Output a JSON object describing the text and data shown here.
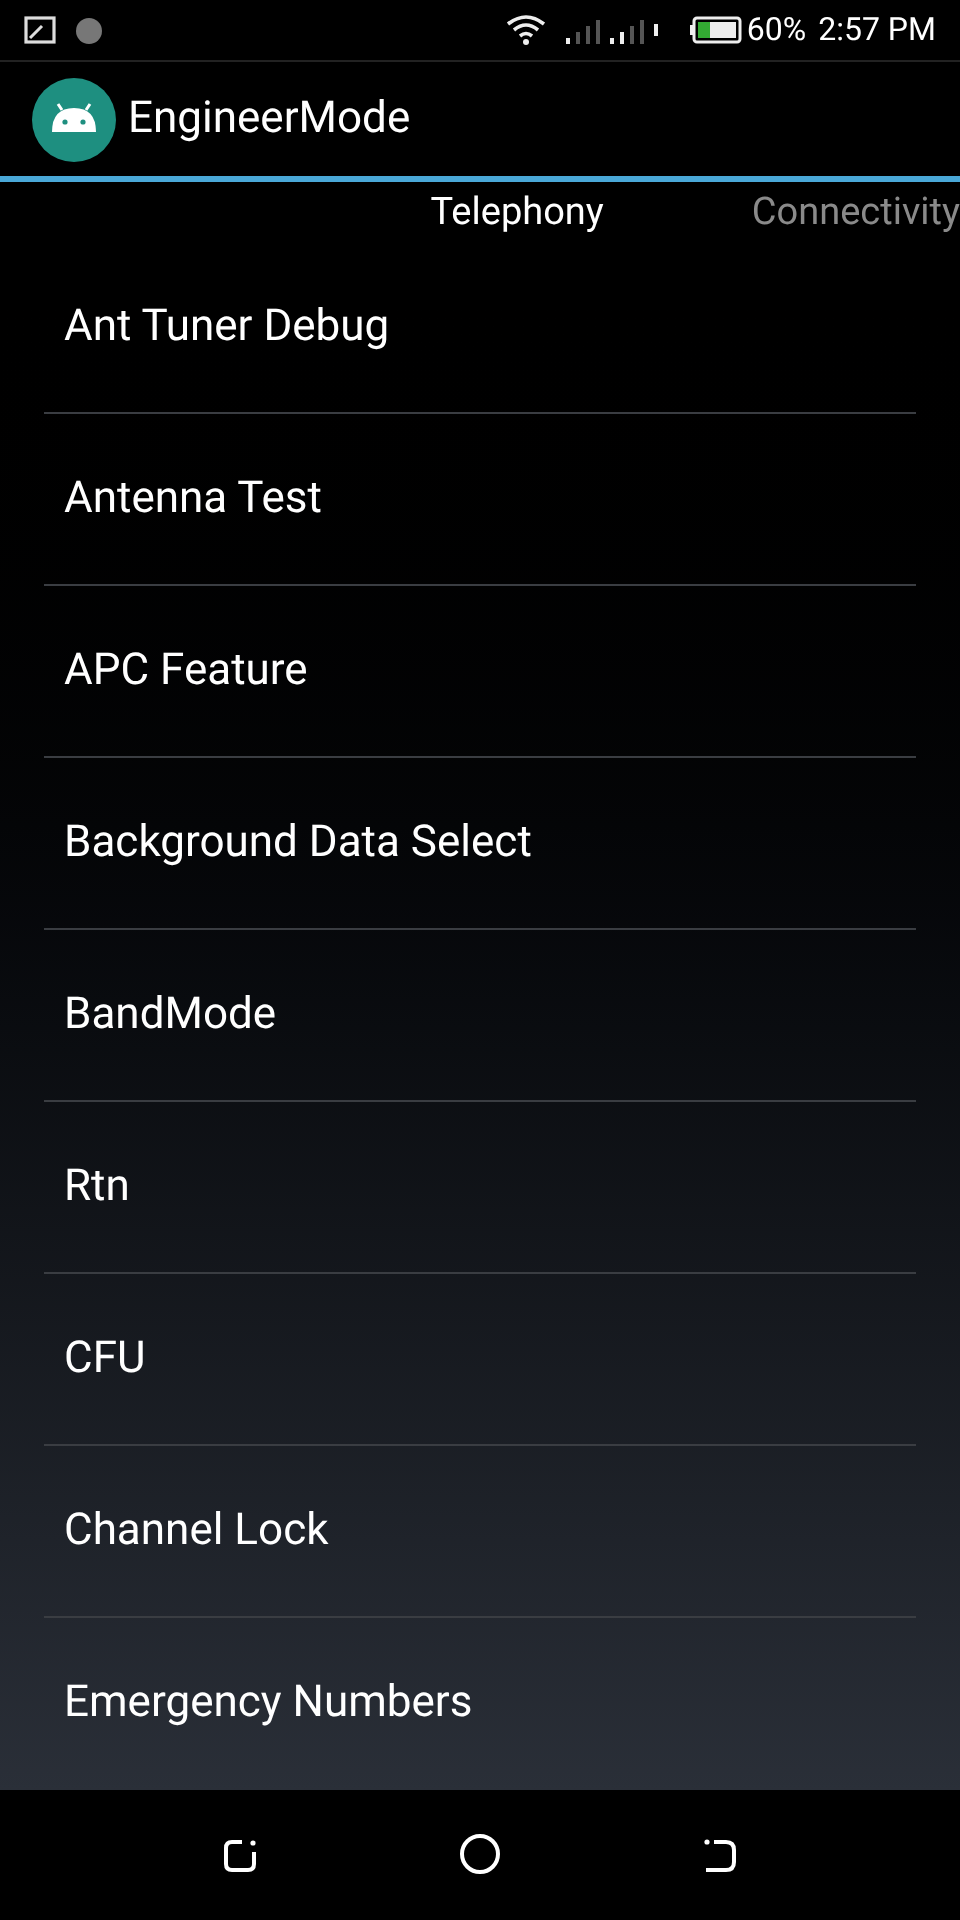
{
  "status_bar": {
    "battery": "60%",
    "time": "2:57 PM"
  },
  "app_bar": {
    "title": "EngineerMode"
  },
  "tabs": [
    {
      "label": "Telephony",
      "selected": true
    },
    {
      "label": "Connectivity",
      "selected": false
    }
  ],
  "items": [
    "Ant Tuner Debug",
    "Antenna Test",
    "APC Feature",
    "Background Data Select",
    "BandMode",
    "Rtn",
    "CFU",
    "Channel Lock",
    "Emergency Numbers"
  ]
}
